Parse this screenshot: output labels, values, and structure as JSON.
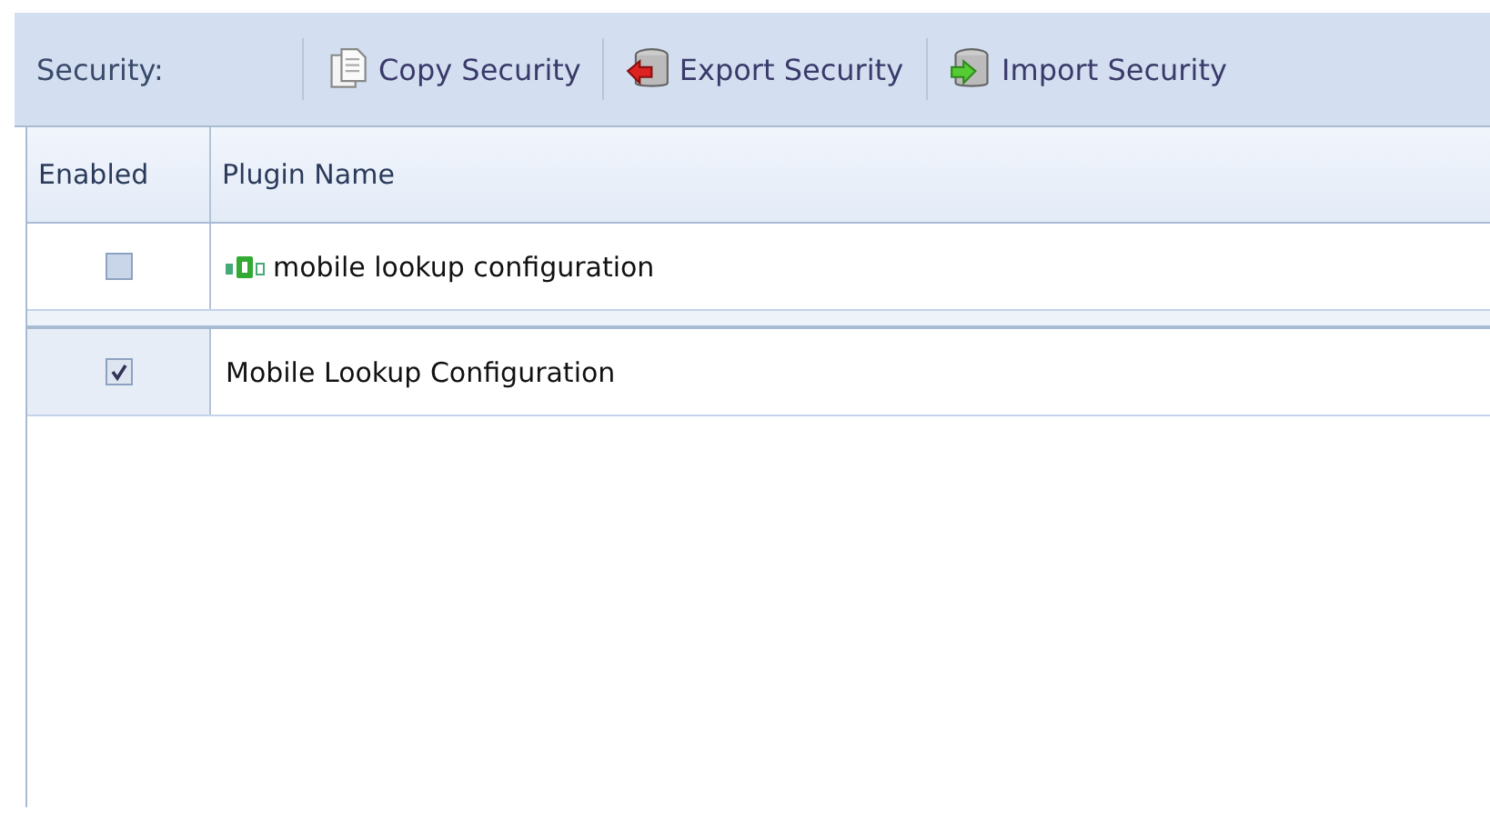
{
  "toolbar": {
    "label": "Security:",
    "buttons": [
      {
        "label": "Copy Security",
        "kind": "copy"
      },
      {
        "label": "Export Security",
        "kind": "export"
      },
      {
        "label": "Import Security",
        "kind": "import"
      }
    ]
  },
  "table": {
    "columns": [
      "Enabled",
      "Plugin Name"
    ],
    "rows": [
      {
        "kind": "group",
        "checked": false,
        "name": "mobile lookup configuration"
      },
      {
        "kind": "item",
        "checked": true,
        "name": "Mobile Lookup Configuration"
      }
    ]
  }
}
